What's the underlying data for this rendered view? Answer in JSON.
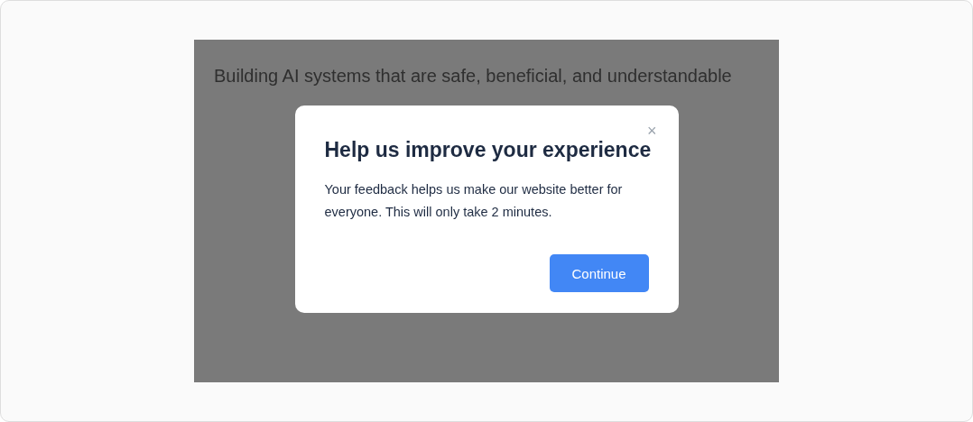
{
  "background": {
    "headline": "Building AI systems that are safe, beneficial, and understandable"
  },
  "dialog": {
    "close": "×",
    "title": "Help us improve your experience",
    "body": "Your feedback helps us make our website better for everyone. This will only take 2 minutes.",
    "button": "Continue"
  }
}
